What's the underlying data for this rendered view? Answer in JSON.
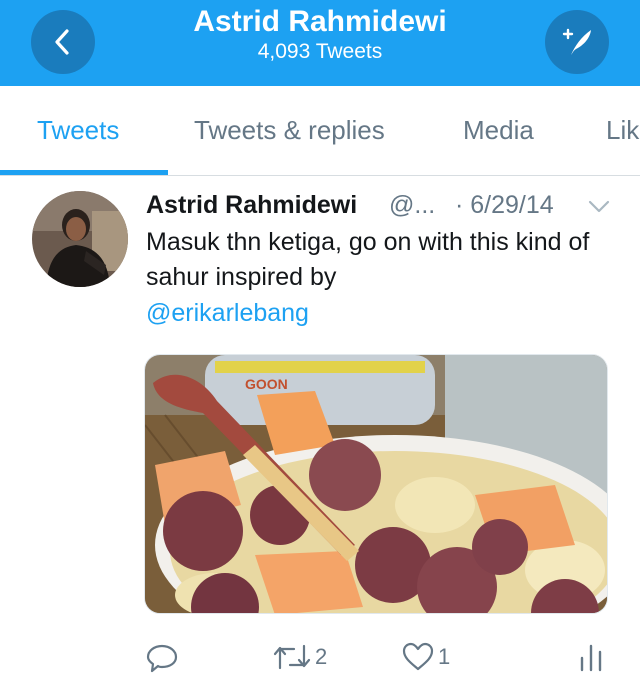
{
  "header": {
    "title": "Astrid Rahmidewi",
    "subtitle": "4,093 Tweets",
    "back_icon": "chevron-left-icon",
    "compose_icon": "compose-tweet-icon",
    "background": "#1da1f2",
    "button_color": "#1a7cbd"
  },
  "tabs": [
    {
      "label": "Tweets",
      "active": true
    },
    {
      "label": "Tweets & replies",
      "active": false
    },
    {
      "label": "Media",
      "active": false
    },
    {
      "label": "Lik",
      "active": false
    }
  ],
  "tweet": {
    "author_name": "Astrid Rahmidewi",
    "handle": "@...",
    "date": "· 6/29/14",
    "text": "Masuk thn ketiga, go on with this kind of sahur inspired by",
    "mention": "@erikarlebang",
    "reply_count": "",
    "retweet_count": "2",
    "like_count": "1"
  },
  "colors": {
    "accent": "#1da1f2",
    "secondary_text": "#657786",
    "primary_text": "#14171a"
  }
}
